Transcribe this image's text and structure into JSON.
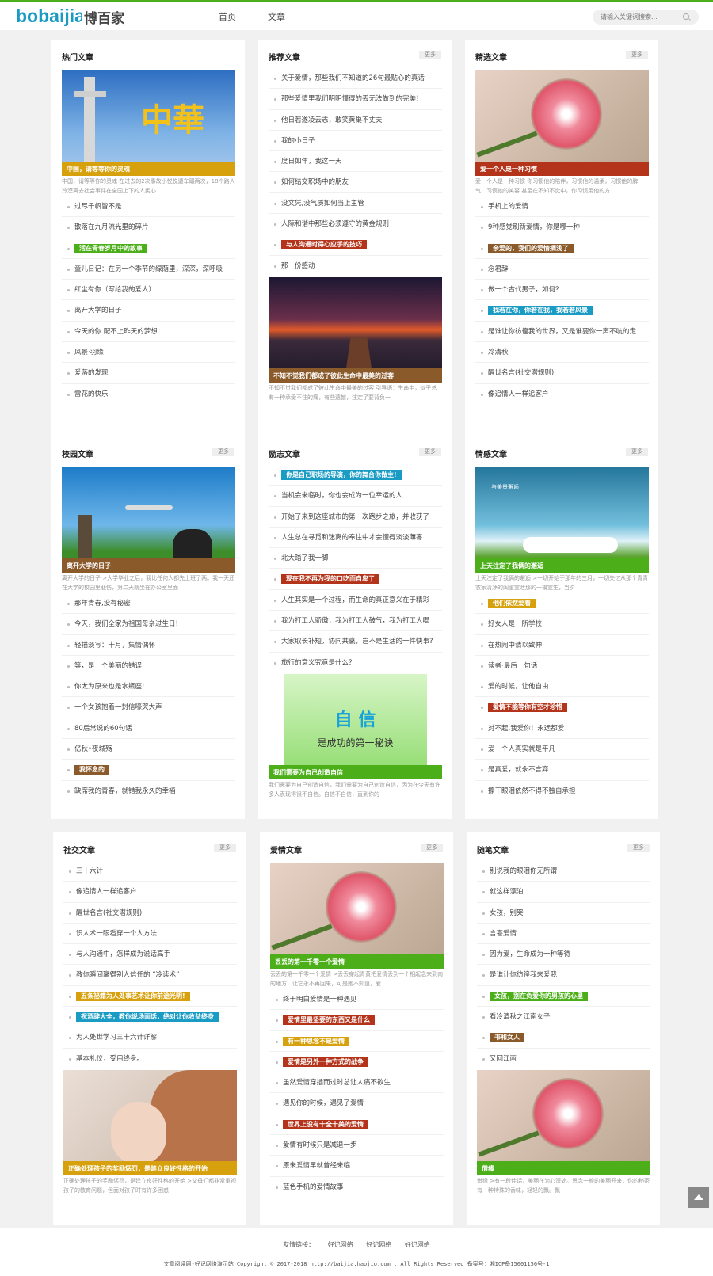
{
  "header": {
    "logo_en": "bobaijia",
    "logo_cn": "博百家",
    "nav": [
      "首页",
      "文章"
    ],
    "search_placeholder": "请输入关键词搜索..."
  },
  "colors": {
    "green": "#4caf1a",
    "blue": "#1a9bc4",
    "gold": "#d6a10d",
    "brown": "#8a5a2b",
    "red": "#b3341a",
    "accent": "#4caf1a"
  },
  "more_label": "更多",
  "cards": [
    {
      "title": "热门文章",
      "has_more": false,
      "thumb_caption": "中国，请等等你的灵魂",
      "caption_color": "#d6a10d",
      "desc": "中国，请等等你的灵魂 在过去的2次事故小悦悦遭车碾两次，18个路人冷漠离去社会事件在全国上下的人民心",
      "items": [
        "过尽千帆皆不是",
        "散落在九月流光里的碎片",
        "活在青春岁月中的故事",
        "童儿日记：在另一个季节的绿荫里，深深，深呼吸",
        "红尘有你（写给我的爱人）",
        "离开大学的日子",
        "今天的你 配不上昨天的梦想",
        "风景·羽缘",
        "爱落的发现",
        "雷花的快乐"
      ],
      "hl": {
        "2": "#4caf1a"
      }
    },
    {
      "title": "推荐文章",
      "has_more": true,
      "thumb_caption": "不知不觉我们都成了彼此生命中最美的过客",
      "caption_color": "#8a5a2b",
      "desc": "不知不觉我们都成了彼此生命中最美的过客 引导语：生命中，似乎总有一种承受不住的痛，有些遗憾，注定了要背负一",
      "items": [
        "关于爱情，那些我们不知道的26句最贴心的真话",
        "那些爱情里我们明明懂得的丢无法做到的完美！",
        "他日若遂凌云志，敢笑黄巢不丈夫",
        "我的小日子",
        "度日如年，我这一天",
        "如何结交职场中的朋友",
        "没文凭,没气质如何当上主管",
        "人际和谐中那些必须遵守的黄金规则",
        "与人沟通时得心应手的技巧",
        "那一份感动"
      ],
      "hl": {
        "8": "#b3341a"
      }
    },
    {
      "title": "精选文章",
      "has_more": true,
      "thumb_caption": "爱一个人是一种习惯",
      "caption_color": "#b3341a",
      "desc": "爱一个人是一种习惯 你习惯他的陪伴，习惯他的温柔，习惯他的脾气，习惯他的笑容 甚至在不知不觉中，你习惯用他的方",
      "items": [
        "手机上的爱情",
        "9种感觉刷新爱情，你是哪一种",
        "亲爱的，我们的爱情搁浅了",
        "念君辞",
        "做一个古代男子，如何？",
        "我若在你，你若在我，我若若风景",
        "是谁让你彷徨我的世界，又是谁要你一声不吭的走",
        "冷清秋",
        "醒世名言(社交潜规则)",
        "像追情人一样追客户"
      ],
      "hl": {
        "2": "#8a5a2b",
        "5": "#1a9bc4"
      }
    },
    {
      "title": "校园文章",
      "has_more": true,
      "thumb_caption": "离开大学的日子",
      "caption_color": "#8a5a2b",
      "desc": "离开大学的日子 >大学毕业之后，我比任何人都先上班了两。我一天还在大学的校园里悲伤，第二天就坐在办公室里面",
      "items": [
        "那年青春,没有秘密",
        "今天，我们全家为祖国母亲过生日!",
        "轻描淡写：十月，集情偶怀",
        "等，是一个美丽的错误",
        "你太为原来也是水瓶座!",
        "一个女孩抱着一封信嚎哭大声",
        "80后常说的60句话",
        "亿秋•夜城殇",
        "我怀念的",
        "缺席我的青春，就错我永久的幸福"
      ],
      "hl": {
        "8": "#8a5a2b"
      }
    },
    {
      "title": "励志文章",
      "has_more": true,
      "thumb_caption": "我们需要为自己创造自信",
      "caption_color": "#4caf1a",
      "desc": "我们需要为自己创造自信，我们需要为自己创造自信，因为在今天有许多人表现得很不自信。自信不自信，直到你的",
      "items": [
        "你是自己职场的导演，你的舞台你做主!",
        "当机会来临时，你也会成为一位幸运的人",
        "开始了来到这座城市的第一次跑步之旅，并收获了",
        "人生总在寻觅和迷离的奉往中才会懂得淡淡薄寡",
        "北大踏了我一脚",
        "现在我不再为我的口吃而自卑了",
        "人生其实是一个过程，而生命的真正意义在于精彩",
        "我为打工人骄傲，我为打工人鼓气，我为打工人喝",
        "大家取长补短，协同共赢，岂不是生活的一件快事?",
        "旅行的意义究竟是什么？"
      ],
      "hl": {
        "0": "#1a9bc4",
        "5": "#b3341a"
      }
    },
    {
      "title": "情感文章",
      "has_more": true,
      "thumb_caption": "上天注定了我俩的邂逅",
      "caption_color": "#4caf1a",
      "desc": "上天注定了我俩的邂逅 >一切开始于那年的三月，一切失忆从那个青青农家清净的闺蜜宣泄那的一模宣生，当夕",
      "items": [
        "他们依然爱着",
        "好女人是一所学校",
        "在热闹中请以致伸",
        "读者·最后一句话",
        "爱的时候，让他自由",
        "爱情不能等你有空才珍惜",
        "对不起,我爱你！永远都爱！",
        "爱一个人真实就是平凡",
        "是真爱，就永不言弃",
        "擦干眼泪依然不得不独自承担"
      ],
      "hl": {
        "0": "#d6a10d",
        "5": "#b3341a"
      }
    },
    {
      "title": "社交文章",
      "has_more": true,
      "thumb_caption": "正确处理孩子的奖励惩罚，是建立良好性格的开始",
      "caption_color": "#d6a10d",
      "desc": "正确处理孩子的奖励惩罚，是建立良好性格的开始 >父母们都非常重视孩子的教育问题，但面对孩子时有许多困惑",
      "items": [
        "三十六计",
        "像追情人一样追客户",
        "醒世名言(社交潜规则)",
        "识人术一眼看穿一个人方法",
        "与人沟通中，怎样成为说话高手",
        "教你瞬间赢得别人信任的 “冷读术”",
        "五条祕籍为人处事艺术让你前途光明!",
        "祝酒辞大全，教你说场面话，绝对让你收益终身",
        "为人处世学习三十六计详解",
        "基本礼仪，受用终身。"
      ],
      "hl": {
        "6": "#d6a10d",
        "7": "#1a9bc4"
      }
    },
    {
      "title": "爱情文章",
      "has_more": true,
      "thumb_caption": "丢丢的第一千零一个爱情",
      "caption_color": "#4caf1a",
      "desc": "丢丢的第一千零一个爱情 >丢丢穿起青黄把爱情丢到一个相起念来到南的地方，让它永不再回来，可是她不知道，爱",
      "items": [
        "终于明白爱情是一种遇见",
        "爱情里最坚要的东西又是什么",
        "有一种思念不是爱情",
        "爱情是另外一种方式的战争",
        "虽然爱情穿插而过时总让人痛不欲生",
        "遇见你的时候，遇见了爱情",
        "世界上没有十全十美的爱情",
        "爱情有时候只是减退一步",
        "原来爱情早就曾经来临",
        "蓝色手机的爱情故事"
      ],
      "hl": {
        "1": "#b3341a",
        "2": "#d6a10d",
        "3": "#b3341a",
        "6": "#b3341a"
      }
    },
    {
      "title": "随笔文章",
      "has_more": true,
      "thumb_caption": "借缘",
      "caption_color": "#4caf1a",
      "desc": "借缘 >有一段佳话，美丽在为心深处。恩念一般的美丽开来，你的秘密有一种特殊的香味，轻轻的飘。飘",
      "items": [
        "别说我的眼泪你无所谓",
        "就这样漂泊",
        "女孩，别哭",
        "言喜爱情",
        "因为爱，生命成为一种等待",
        "是谁让你彷徨我来爱我",
        "女孩，别在负爱你的男孩的心里",
        "看冷清秋之江南女子",
        "书和女人",
        "又回江南"
      ],
      "hl": {
        "6": "#4caf1a",
        "8": "#8a5a2b"
      }
    }
  ],
  "footer": {
    "links_label": "友情链接：",
    "links": [
      "好记网络",
      "好记网络",
      "好记网络"
    ],
    "copyright": "文章阅读网-好记网络演示站 Copyright © 2017-2018 http://baijia.haojio.com , All Rights Reserved 备案号：湘ICP备15001156号-1"
  }
}
